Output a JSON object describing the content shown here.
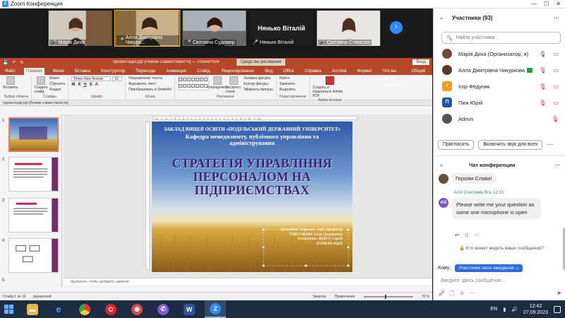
{
  "window": {
    "title": "Zoom Конференция",
    "controls": [
      "—",
      "☐",
      "✕"
    ]
  },
  "gallery": {
    "tiles": [
      {
        "name": "Марія Диха",
        "muted": false
      },
      {
        "name": "Алла Дмитрівна Чикурк...",
        "muted": true,
        "active": true
      },
      {
        "name": "Світлана Судомир",
        "muted": true
      },
      {
        "name": "Нянько Віталій",
        "muted": true,
        "big_label": "Нянько Віталій"
      },
      {
        "name": "Світлана Станєсян",
        "muted": true
      }
    ],
    "next_icon": "chevron-right-icon"
  },
  "powerpoint": {
    "titlebar": {
      "center": "презентація.ppt [Режим совместимости] — PowerPoint",
      "context": "Средства рисования",
      "login": "Вход"
    },
    "tabs": [
      "Файл",
      "Главная",
      "Меню",
      "Вставка",
      "Конструктор",
      "Переходы",
      "Анимация",
      "Слайд-шоу",
      "Рецензирование",
      "Вид",
      "Office Tab",
      "Справка",
      "Acrobat",
      "Формат",
      "Что вы хотите сделать?"
    ],
    "share": "Общий доступ",
    "ribbon": {
      "paste": "Вставить",
      "clipboard": "Буфер обмена",
      "new_slide": "Создать слайд",
      "layout": "Макет",
      "reset": "Сбросить",
      "section": "Раздел",
      "slides": "Слайды",
      "font_name": "Times New Roman",
      "font_size": "16",
      "font": "Шрифт",
      "text_dir": "Направление текста",
      "align_text": "Выровнять текст",
      "smartart": "Преобразовать в SmartArt",
      "paragraph": "Абзац",
      "arrange": "Упорядочить",
      "quick_styles": "Экспресс-стили",
      "fill": "Заливка фигуры",
      "outline": "Контур фигуры",
      "effects": "Эффекты фигуры",
      "drawing": "Рисование",
      "find": "Найти",
      "replace": "Заменить",
      "select": "Выделить",
      "editing": "Редактирование",
      "adobe": "Создать и поделиться Adobe PDF",
      "acrobat": "Adobe Acrobat"
    },
    "doc_tab": "презентація.ppt [Режим совместимости]",
    "thumb_numbers": [
      "1",
      "2",
      "3",
      "4",
      "5"
    ],
    "slide": {
      "line1": "ЗАКЛАД ВИЩОЇ ОСВІТИ «ПОДІЛЬСЬКИЙ ДЕРЖАВНИЙ УНІВЕРСИТЕТ»",
      "line2": "Кафедра менеджменту, публічного управління та адміністрування",
      "title": "СТРАТЕГІЯ УПРАВЛІННЯ ПЕРСОНАЛОМ НА ПІДПРИЄМСТВАХ",
      "reporter1": "Доповідач : д-р екон. наук, професор",
      "reporter2": "ЧИКУРКОВА Алла Дмитрівна",
      "reporter3": "Аспіранти: ДІДУХ Сергій",
      "reporter4": "КУРИЛО Юрій"
    },
    "notes_placeholder": "Щелкните, чтобы добавить заметки",
    "status": {
      "slide": "Слайд 1 из 16",
      "lang": "украинский",
      "notes": "Заметки",
      "comments": "Примечания",
      "zoom": "70 %"
    }
  },
  "participants": {
    "title": "Участники (93)",
    "search_placeholder": "Найти участника",
    "list": [
      {
        "name": "Марія Диха (Организатор, я)",
        "initial": "",
        "avatar_color": "#6b4a3a"
      },
      {
        "name": "Алла Дмитрівна Чикуркова",
        "initial": "",
        "avatar_color": "#5a3a2a"
      },
      {
        "name": "Ігор Федуняк",
        "initial": "I",
        "avatar_color": "#f29b1d"
      },
      {
        "name": "Пиж Юрій",
        "initial": "П",
        "avatar_color": "#2255a4"
      },
      {
        "name": "Admin",
        "initial": "",
        "avatar_color": "#555"
      }
    ],
    "invite": "Пригласить",
    "unmute_all": "Включить звук для всех"
  },
  "chat": {
    "title": "Чат конференции",
    "msg1": "Героям Слава!",
    "sender": "Amit Goel",
    "to_label": "кому",
    "to_target": "Все",
    "time": "12:33",
    "avatar": "AG",
    "msg2": "Please write me your question as some one microphone is open",
    "who_can": "Кто может видеть ваши сообщения?",
    "to": "Кому:",
    "to_select": "Участники зала ожидания",
    "input_placeholder": "Введите здесь сообщение..."
  },
  "taskbar": {
    "lang": "EN",
    "time": "12:42",
    "date": "27.09.2023"
  }
}
